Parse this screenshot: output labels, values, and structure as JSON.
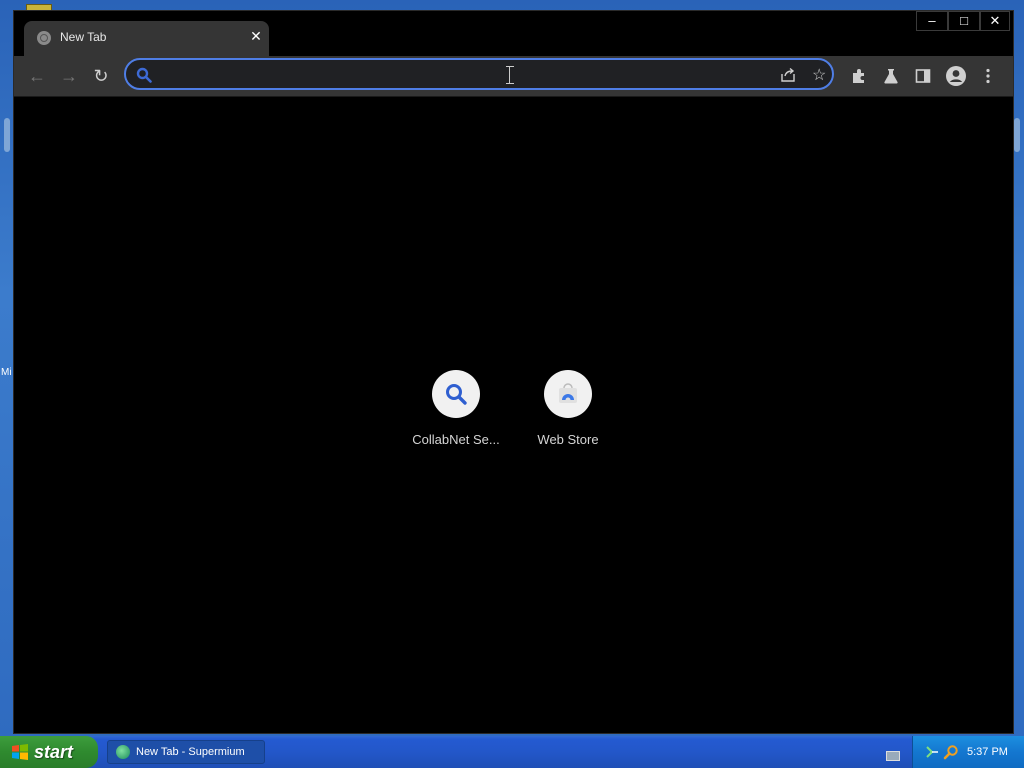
{
  "desktop": {
    "edge_text": "Mi"
  },
  "browser": {
    "tab": {
      "title": "New Tab",
      "close_glyph": "✕"
    },
    "window_controls": {
      "minimize": "–",
      "maximize": "□",
      "close": "✕"
    },
    "toolbar": {
      "back_glyph": "←",
      "forward_glyph": "→",
      "reload_glyph": "↻"
    },
    "omnibox": {
      "value": "",
      "placeholder": ""
    },
    "toolbar_icons": [
      "share-icon",
      "star-icon",
      "extensions-icon",
      "labs-flask-icon",
      "side-panel-icon",
      "profile-avatar-icon",
      "more-menu-icon"
    ],
    "shortcuts": [
      {
        "label": "CollabNet Se...",
        "icon": "search-icon"
      },
      {
        "label": "Web Store",
        "icon": "web-store-icon"
      }
    ]
  },
  "taskbar": {
    "start_label": "start",
    "task_button_label": "New Tab - Supermium",
    "clock": "5:37 PM"
  },
  "colors": {
    "omnibox_focus": "#4f7ee6",
    "search_icon": "#3d6ad6",
    "taskbar": "#245ad1",
    "start": "#2f8a2f"
  }
}
